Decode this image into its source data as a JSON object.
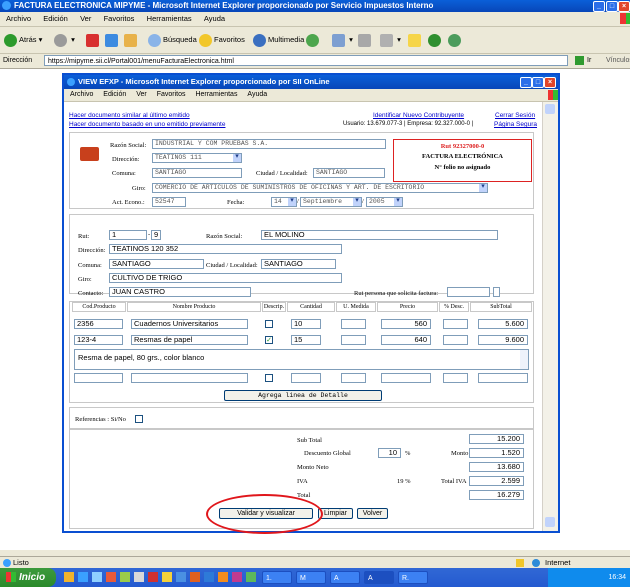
{
  "outer_window": {
    "title": "FACTURA ELECTRONICA MIPYME - Microsoft Internet Explorer proporcionado por Servicio Impuestos Interno",
    "menu": [
      "Archivo",
      "Edición",
      "Ver",
      "Favoritos",
      "Herramientas",
      "Ayuda"
    ],
    "toolbar": {
      "back": "Atrás",
      "search": "Búsqueda",
      "favorites": "Favoritos",
      "multimedia": "Multimedia"
    },
    "address_label": "Dirección",
    "url": "https://mipyme.sii.cl/Portal001/menuFacturaElectronica.html",
    "go_label": "Ir",
    "links_label": "Vínculos",
    "status_left": "Listo",
    "status_zone": "Internet"
  },
  "taskbar": {
    "start": "Inicio",
    "tasks": [
      "1.",
      "M",
      "A",
      "A",
      "R."
    ],
    "clock": "16:34"
  },
  "popup": {
    "title": "VIEW EFXP - Microsoft Internet Explorer proporcionado por SII OnLine",
    "menu": [
      "Archivo",
      "Edición",
      "Ver",
      "Favoritos",
      "Herramientas",
      "Ayuda"
    ],
    "links": {
      "similar_last": "Hacer documento similar al último emitido",
      "based_previous": "Hacer documento basado en uno emitido previamente",
      "identify": "Identificar Nuevo Contribuyente",
      "close_session": "Cerrar Sesión",
      "secure_page": "Página Segura"
    },
    "user_info": "Usuario: 13.679.077-3 | Empresa: 92.327.000-0 |",
    "issuer": {
      "razon_social_label": "Razón Social:",
      "razon_social": "INDUSTRIAL Y COM PRUEBAS S.A.",
      "direccion_label": "Dirección:",
      "direccion": "TEATINOS 111",
      "comuna_label": "Comuna:",
      "comuna": "SANTIAGO",
      "ciudad_label": "Ciudad / Localidad:",
      "ciudad": "SANTIAGO",
      "giro_label": "Giro:",
      "giro": "COMERCIO DE ARTICULOS DE SUMINISTROS DE OFICINAS Y ART. DE ESCRITORIO",
      "act_econ_label": "Act. Econo.:",
      "act_econ": "52547",
      "fecha_label": "Fecha:",
      "fecha_dia": "14",
      "fecha_mes": "Septiembre",
      "fecha_anio": "2005"
    },
    "doc_box": {
      "rut": "Rut 92327000-0",
      "tipo": "FACTURA ELECTRÓNICA",
      "folio": "N° folio no asignado"
    },
    "receiver": {
      "rut_label": "Rut:",
      "rut": "1",
      "dv": "9",
      "razon_social_label": "Razón Social:",
      "razon_social": "EL MOLINO",
      "direccion_label": "Dirección:",
      "direccion": "TEATINOS 120 352",
      "comuna_label": "Comuna:",
      "comuna": "SANTIAGO",
      "ciudad_label": "Ciudad / Localidad:",
      "ciudad": "SANTIAGO",
      "giro_label": "Giro:",
      "giro": "CULTIVO DE TRIGO",
      "contacto_label": "Contacto:",
      "contacto": "JUAN CASTRO",
      "rut_solicita_label": "Rut persona que solicita factura:",
      "rut_solicita": ""
    },
    "detail": {
      "headers": [
        "Cod.Producto",
        "Nombre Producto",
        "Descrip.",
        "Cantidad",
        "U. Medida",
        "Precio",
        "% Desc.",
        "SubTotal"
      ],
      "rows": [
        {
          "codigo": "2356",
          "nombre": "Cuadernos Universitarios",
          "descrip": false,
          "cantidad": "10",
          "unidad": "",
          "precio": "560",
          "desc": "",
          "subtotal": "5.600"
        },
        {
          "codigo": "123-4",
          "nombre": "Resmas de papel",
          "descrip": true,
          "cantidad": "15",
          "unidad": "",
          "precio": "640",
          "desc": "",
          "subtotal": "9.600"
        }
      ],
      "description_text": "Resma de papel, 80 grs., color blanco",
      "add_line_button": "Agrega linea de Detalle"
    },
    "references_label": "Referencias : Si/No",
    "totals": {
      "subtotal_label": "Sub Total",
      "subtotal": "15.200",
      "descuento_label": "Descuento Global",
      "descuento_pct": "10",
      "pct_sign": "%",
      "monto_label": "Monto",
      "monto": "1.520",
      "neto_label": "Monto Neto",
      "neto": "13.680",
      "iva_label": "IVA",
      "iva_pct": "19 %",
      "total_iva_label": "Total IVA",
      "total_iva": "2.599",
      "total_label": "Total",
      "total": "16.279"
    },
    "buttons": {
      "validar": "Validar y visualizar",
      "limpiar": "Limpiar",
      "volver": "Volver"
    }
  }
}
